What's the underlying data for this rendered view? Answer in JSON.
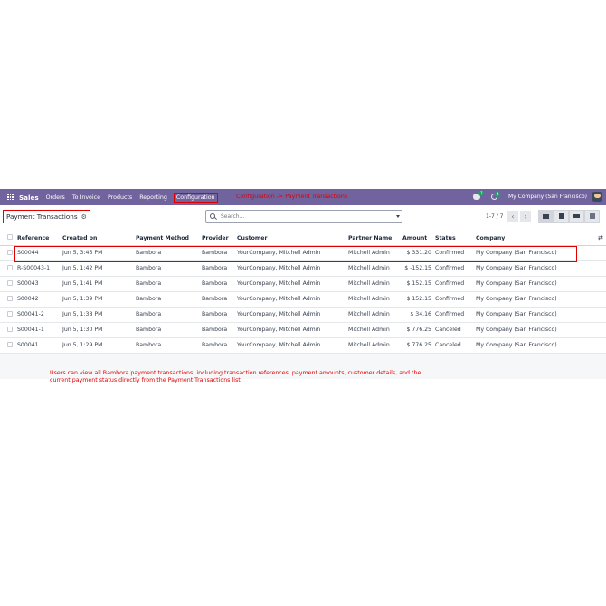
{
  "navbar": {
    "app_name": "Sales",
    "menu": [
      "Orders",
      "To Invoice",
      "Products",
      "Reporting",
      "Configuration"
    ],
    "annotation": "Configuration -> Payment Transactions",
    "chat_badge": "7",
    "activity_badge": "4",
    "company": "My Company (San Francisco)"
  },
  "control": {
    "breadcrumb": "Payment Transactions",
    "search_placeholder": "Search...",
    "pager": "1-7 / 7"
  },
  "table": {
    "headers": [
      "Reference",
      "Created on",
      "Payment Method",
      "Provider",
      "Customer",
      "Partner Name",
      "Amount",
      "Status",
      "Company"
    ],
    "rows": [
      [
        "S00044",
        "Jun 5, 3:45 PM",
        "Bambora",
        "Bambora",
        "YourCompany, Mitchell Admin",
        "Mitchell Admin",
        "$ 331.20",
        "Confirmed",
        "My Company (San Francisco)"
      ],
      [
        "R-S00043-1",
        "Jun 5, 1:42 PM",
        "Bambora",
        "Bambora",
        "YourCompany, Mitchell Admin",
        "Mitchell Admin",
        "$ -152.15",
        "Confirmed",
        "My Company (San Francisco)"
      ],
      [
        "S00043",
        "Jun 5, 1:41 PM",
        "Bambora",
        "Bambora",
        "YourCompany, Mitchell Admin",
        "Mitchell Admin",
        "$ 152.15",
        "Confirmed",
        "My Company (San Francisco)"
      ],
      [
        "S00042",
        "Jun 5, 1:39 PM",
        "Bambora",
        "Bambora",
        "YourCompany, Mitchell Admin",
        "Mitchell Admin",
        "$ 152.15",
        "Confirmed",
        "My Company (San Francisco)"
      ],
      [
        "S00041-2",
        "Jun 5, 1:38 PM",
        "Bambora",
        "Bambora",
        "YourCompany, Mitchell Admin",
        "Mitchell Admin",
        "$ 34.16",
        "Confirmed",
        "My Company (San Francisco)"
      ],
      [
        "S00041-1",
        "Jun 5, 1:30 PM",
        "Bambora",
        "Bambora",
        "YourCompany, Mitchell Admin",
        "Mitchell Admin",
        "$ 776.25",
        "Canceled",
        "My Company (San Francisco)"
      ],
      [
        "S00041",
        "Jun 5, 1:29 PM",
        "Bambora",
        "Bambora",
        "YourCompany, Mitchell Admin",
        "Mitchell Admin",
        "$ 776.25",
        "Canceled",
        "My Company (San Francisco)"
      ]
    ]
  },
  "note": "Users can view all Bambora payment transactions, including transaction references, payment amounts, customer details, and the current payment status directly from the Payment Transactions list.",
  "colors": {
    "navbar": "#71639e",
    "annotation": "#e00000",
    "badge": "#22a06b"
  }
}
